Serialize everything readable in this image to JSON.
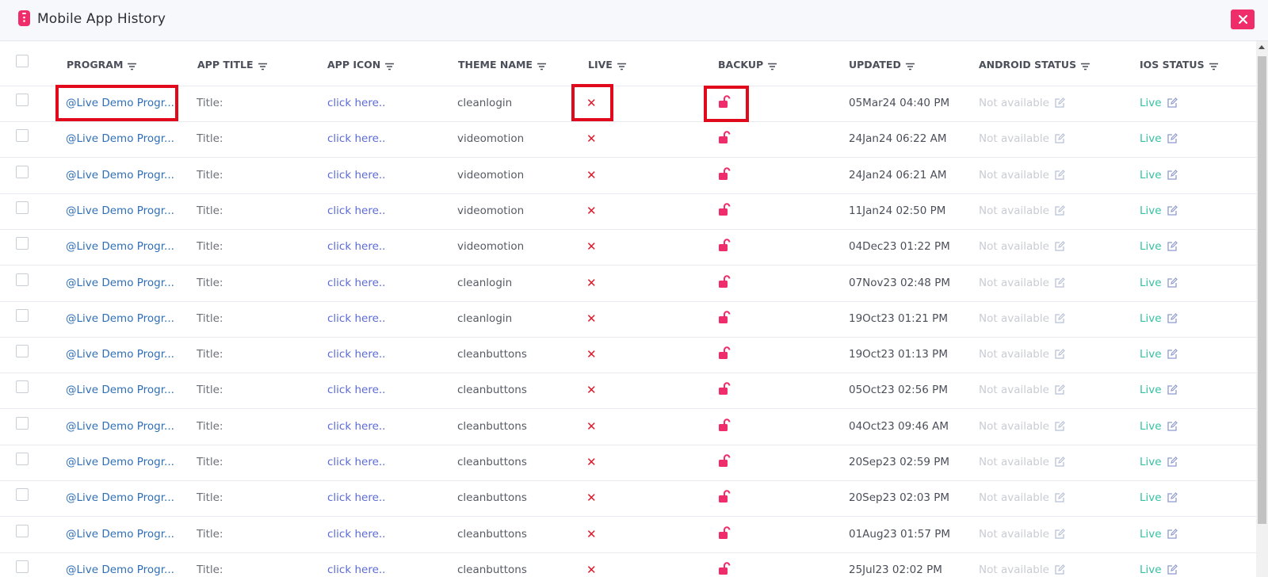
{
  "header": {
    "title": "Mobile App History",
    "close_label": "×"
  },
  "columns": [
    {
      "label": "PROGRAM",
      "key": "program"
    },
    {
      "label": "APP TITLE",
      "key": "title"
    },
    {
      "label": "APP ICON",
      "key": "icon"
    },
    {
      "label": "THEME NAME",
      "key": "theme"
    },
    {
      "label": "LIVE",
      "key": "live"
    },
    {
      "label": "BACKUP",
      "key": "backup"
    },
    {
      "label": "UPDATED",
      "key": "updated"
    },
    {
      "label": "ANDROID STATUS",
      "key": "android"
    },
    {
      "label": "IOS STATUS",
      "key": "ios"
    }
  ],
  "rows": [
    {
      "program": "@Live Demo Progr...",
      "title": "Title:",
      "icon": "click here..",
      "theme": "cleanlogin",
      "live": "✕",
      "updated": "05Mar24 04:40 PM",
      "android": "Not available",
      "ios": "Live"
    },
    {
      "program": "@Live Demo Progr...",
      "title": "Title:",
      "icon": "click here..",
      "theme": "videomotion",
      "live": "✕",
      "updated": "24Jan24 06:22 AM",
      "android": "Not available",
      "ios": "Live"
    },
    {
      "program": "@Live Demo Progr...",
      "title": "Title:",
      "icon": "click here..",
      "theme": "videomotion",
      "live": "✕",
      "updated": "24Jan24 06:21 AM",
      "android": "Not available",
      "ios": "Live"
    },
    {
      "program": "@Live Demo Progr...",
      "title": "Title:",
      "icon": "click here..",
      "theme": "videomotion",
      "live": "✕",
      "updated": "11Jan24 02:50 PM",
      "android": "Not available",
      "ios": "Live"
    },
    {
      "program": "@Live Demo Progr...",
      "title": "Title:",
      "icon": "click here..",
      "theme": "videomotion",
      "live": "✕",
      "updated": "04Dec23 01:22 PM",
      "android": "Not available",
      "ios": "Live"
    },
    {
      "program": "@Live Demo Progr...",
      "title": "Title:",
      "icon": "click here..",
      "theme": "cleanlogin",
      "live": "✕",
      "updated": "07Nov23 02:48 PM",
      "android": "Not available",
      "ios": "Live"
    },
    {
      "program": "@Live Demo Progr...",
      "title": "Title:",
      "icon": "click here..",
      "theme": "cleanlogin",
      "live": "✕",
      "updated": "19Oct23 01:21 PM",
      "android": "Not available",
      "ios": "Live"
    },
    {
      "program": "@Live Demo Progr...",
      "title": "Title:",
      "icon": "click here..",
      "theme": "cleanbuttons",
      "live": "✕",
      "updated": "19Oct23 01:13 PM",
      "android": "Not available",
      "ios": "Live"
    },
    {
      "program": "@Live Demo Progr...",
      "title": "Title:",
      "icon": "click here..",
      "theme": "cleanbuttons",
      "live": "✕",
      "updated": "05Oct23 02:56 PM",
      "android": "Not available",
      "ios": "Live"
    },
    {
      "program": "@Live Demo Progr...",
      "title": "Title:",
      "icon": "click here..",
      "theme": "cleanbuttons",
      "live": "✕",
      "updated": "04Oct23 09:46 AM",
      "android": "Not available",
      "ios": "Live"
    },
    {
      "program": "@Live Demo Progr...",
      "title": "Title:",
      "icon": "click here..",
      "theme": "cleanbuttons",
      "live": "✕",
      "updated": "20Sep23 02:59 PM",
      "android": "Not available",
      "ios": "Live"
    },
    {
      "program": "@Live Demo Progr...",
      "title": "Title:",
      "icon": "click here..",
      "theme": "cleanbuttons",
      "live": "✕",
      "updated": "20Sep23 02:03 PM",
      "android": "Not available",
      "ios": "Live"
    },
    {
      "program": "@Live Demo Progr...",
      "title": "Title:",
      "icon": "click here..",
      "theme": "cleanbuttons",
      "live": "✕",
      "updated": "01Aug23 01:57 PM",
      "android": "Not available",
      "ios": "Live"
    },
    {
      "program": "@Live Demo Progr...",
      "title": "Title:",
      "icon": "click here..",
      "theme": "cleanbuttons",
      "live": "✕",
      "updated": "25Jul23 02:02 PM",
      "android": "Not available",
      "ios": "Live"
    }
  ],
  "icons": {
    "backup": "unlock-icon",
    "edit": "edit-icon",
    "filter": "filter-icon",
    "logo": "mobile-app-icon"
  },
  "colors": {
    "accent": "#ef2d6a",
    "live_icon": "#e0192b",
    "link": "#2f6fb7",
    "ios_live": "#36c0a3",
    "highlight": "#e1091c"
  }
}
